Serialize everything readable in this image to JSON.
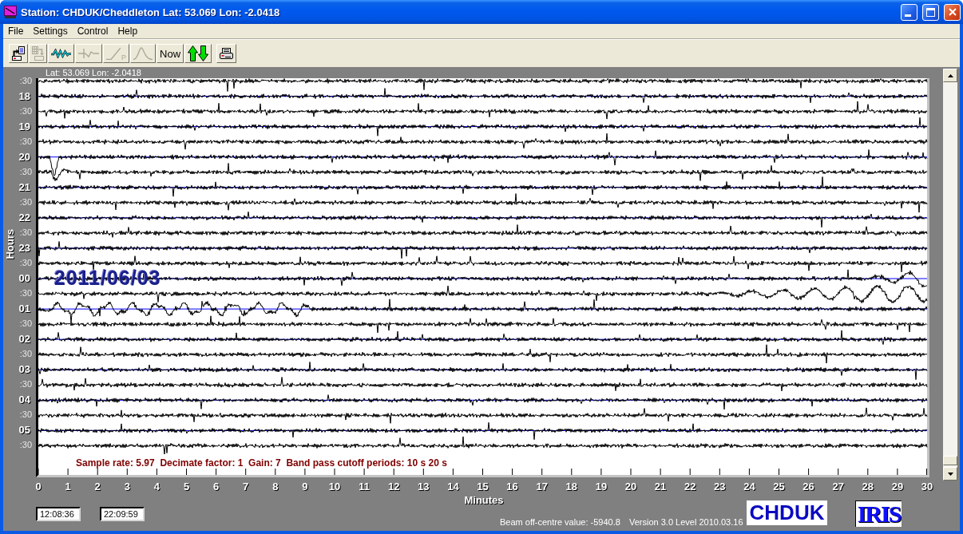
{
  "window": {
    "title": "Station: CHDUK/Cheddleton Lat: 53.069 Lon: -2.0418"
  },
  "menu": [
    {
      "label": "File"
    },
    {
      "label": "Settings"
    },
    {
      "label": "Control"
    },
    {
      "label": "Help"
    }
  ],
  "toolbar": [
    {
      "kind": "icon",
      "disabled": false
    },
    {
      "kind": "icon",
      "disabled": true
    },
    {
      "kind": "icon",
      "disabled": false
    },
    {
      "kind": "icon",
      "disabled": true
    },
    {
      "kind": "icon",
      "disabled": true,
      "label": "P"
    },
    {
      "kind": "icon",
      "disabled": true
    },
    {
      "kind": "text",
      "label": "Now",
      "disabled": false
    },
    {
      "kind": "icon",
      "disabled": false
    },
    {
      "kind": "icon",
      "disabled": false
    }
  ],
  "plot": {
    "location": "Lat: 53.069 Lon: -2.0418",
    "y_axis_title": "Hours",
    "rows": [
      {
        "label": ":30",
        "kind": "half"
      },
      {
        "label": "18",
        "kind": "hour"
      },
      {
        "label": ":30",
        "kind": "half"
      },
      {
        "label": "19",
        "kind": "hour"
      },
      {
        "label": ":30",
        "kind": "half"
      },
      {
        "label": "20",
        "kind": "hour"
      },
      {
        "label": ":30",
        "kind": "half"
      },
      {
        "label": "21",
        "kind": "hour"
      },
      {
        "label": ":30",
        "kind": "half"
      },
      {
        "label": "22",
        "kind": "hour"
      },
      {
        "label": ":30",
        "kind": "half"
      },
      {
        "label": "23",
        "kind": "hour"
      },
      {
        "label": ":30",
        "kind": "half"
      },
      {
        "label": "00",
        "kind": "hour"
      },
      {
        "label": ":30",
        "kind": "half"
      },
      {
        "label": "01",
        "kind": "hour"
      },
      {
        "label": ":30",
        "kind": "half"
      },
      {
        "label": "02",
        "kind": "hour"
      },
      {
        "label": ":30",
        "kind": "half"
      },
      {
        "label": "03",
        "kind": "hour"
      },
      {
        "label": ":30",
        "kind": "half"
      },
      {
        "label": "04",
        "kind": "hour"
      },
      {
        "label": ":30",
        "kind": "half"
      },
      {
        "label": "05",
        "kind": "hour"
      },
      {
        "label": ":30",
        "kind": "half"
      }
    ],
    "date": "2011/06/03",
    "info": "Sample rate: 5.97  Decimate factor: 1  Gain: 7  Band pass cutoff periods: 10 s 20 s",
    "x_ticks": [
      "0",
      "1",
      "2",
      "3",
      "4",
      "5",
      "6",
      "7",
      "8",
      "9",
      "10",
      "11",
      "12",
      "13",
      "14",
      "15",
      "16",
      "17",
      "18",
      "19",
      "20",
      "21",
      "22",
      "23",
      "24",
      "25",
      "26",
      "27",
      "28",
      "29",
      "30"
    ],
    "x_axis_title": "Minutes"
  },
  "footer": {
    "start_time": "12:08:36",
    "end_time": "22:09:59",
    "beam_value": "Beam off-centre value: -5940.8",
    "version": "Version 3.0 Level 2010.03.16",
    "station_logo": "CHDUK",
    "network_logo": "IRIS"
  }
}
